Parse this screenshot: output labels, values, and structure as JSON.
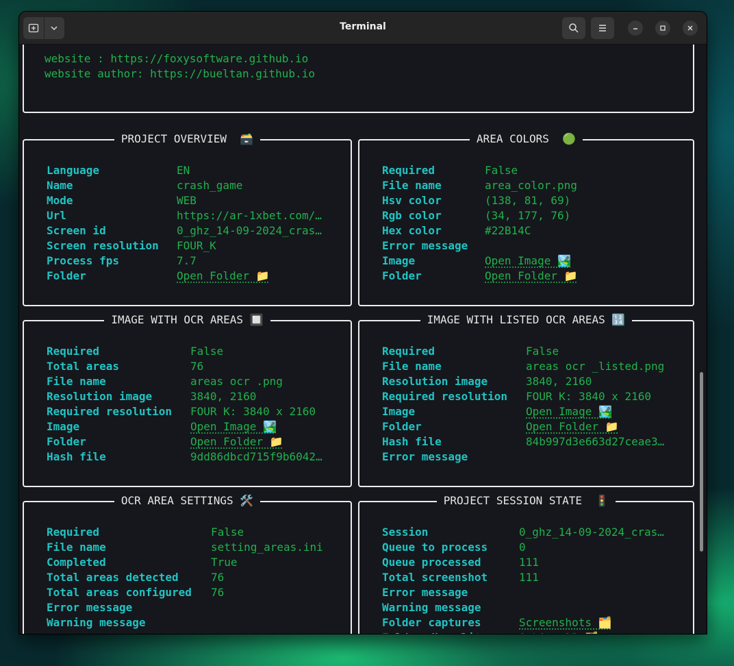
{
  "window": {
    "title": "Terminal"
  },
  "web_lines": [
    "website : https://foxysoftware.github.io",
    "website author: https://bueltan.github.io"
  ],
  "panels": {
    "overview": {
      "title": "PROJECT OVERVIEW  🗃️",
      "rows": [
        {
          "k": "Language",
          "v": "EN"
        },
        {
          "k": "Name",
          "v": "crash_game"
        },
        {
          "k": "Mode",
          "v": "WEB"
        },
        {
          "k": "Url",
          "v": "https://ar-1xbet.com/…"
        },
        {
          "k": "Screen id",
          "v": "0_ghz_14-09-2024_cras…"
        },
        {
          "k": "Screen resolution",
          "v": "FOUR_K"
        },
        {
          "k": "Process fps",
          "v": "7.7"
        },
        {
          "k": "Folder",
          "v": "Open Folder 📁"
        }
      ]
    },
    "area_colors": {
      "title": "AREA COLORS  🟢",
      "rows": [
        {
          "k": "Required",
          "v": "False"
        },
        {
          "k": "File name",
          "v": "area_color.png"
        },
        {
          "k": "Hsv color",
          "v": "(138, 81, 69)"
        },
        {
          "k": "Rgb color",
          "v": "(34, 177, 76)"
        },
        {
          "k": "Hex color",
          "v": "#22B14C"
        },
        {
          "k": "Error message",
          "v": ""
        },
        {
          "k": "Image",
          "v": "Open Image 🏞️"
        },
        {
          "k": "Folder",
          "v": "Open Folder 📁"
        }
      ]
    },
    "ocr_areas": {
      "title": "IMAGE WITH OCR AREAS 🔲",
      "rows": [
        {
          "k": "Required",
          "v": "False"
        },
        {
          "k": "Total areas",
          "v": "76"
        },
        {
          "k": "File name",
          "v": "areas ocr .png"
        },
        {
          "k": "Resolution image",
          "v": "3840, 2160"
        },
        {
          "k": "Required resolution",
          "v": "FOUR K: 3840 x 2160"
        },
        {
          "k": "Image",
          "v": "Open Image 🏞️"
        },
        {
          "k": "Folder",
          "v": "Open Folder 📁"
        },
        {
          "k": "Hash file",
          "v": "9dd86dbcd715f9b6042…"
        }
      ]
    },
    "listed_ocr": {
      "title": "IMAGE WITH LISTED OCR AREAS 🔢",
      "rows": [
        {
          "k": "Required",
          "v": "False"
        },
        {
          "k": "File name",
          "v": "areas ocr _listed.png"
        },
        {
          "k": "Resolution image",
          "v": "3840, 2160"
        },
        {
          "k": "Required resolution",
          "v": "FOUR K: 3840 x 2160"
        },
        {
          "k": "Image",
          "v": "Open Image 🏞️"
        },
        {
          "k": "Folder",
          "v": "Open Folder 📁"
        },
        {
          "k": "Hash file",
          "v": "84b997d3e663d27ceae3…"
        },
        {
          "k": "Error message",
          "v": ""
        }
      ]
    },
    "ocr_settings": {
      "title": "OCR AREA SETTINGS 🛠️",
      "rows": [
        {
          "k": "Required",
          "v": "False"
        },
        {
          "k": "File name",
          "v": "setting_areas.ini"
        },
        {
          "k": "Completed",
          "v": "True"
        },
        {
          "k": "Total areas detected",
          "v": "76"
        },
        {
          "k": "Total areas configured",
          "v": "76"
        },
        {
          "k": "Error message",
          "v": ""
        },
        {
          "k": "Warning message",
          "v": ""
        }
      ]
    },
    "session": {
      "title": "PROJECT SESSION STATE  🚦",
      "rows": [
        {
          "k": "Session",
          "v": "0_ghz_14-09-2024_cras…"
        },
        {
          "k": "Queue to process",
          "v": "0"
        },
        {
          "k": "Queue processed",
          "v": "111"
        },
        {
          "k": "Total screenshot",
          "v": "111"
        },
        {
          "k": "Error message",
          "v": ""
        },
        {
          "k": "Warning message",
          "v": ""
        },
        {
          "k": "Folder captures",
          "v": "Screenshots 🗂️"
        },
        {
          "k": "Folder db sqlite",
          "v": "SqLite DB 🗂️"
        }
      ]
    }
  }
}
